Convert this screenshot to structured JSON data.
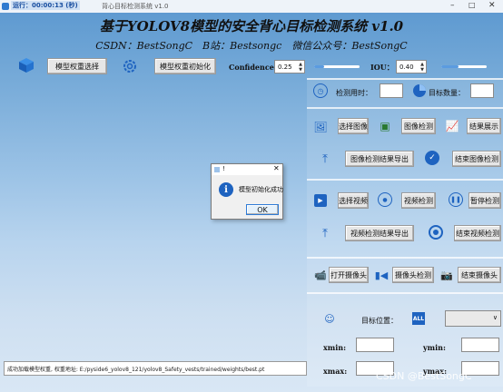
{
  "window": {
    "timer": "运行：00:00:13 (秒)",
    "title": "背心目标检测系统 v1.0"
  },
  "header": {
    "title": "基于YOLOV8模型的安全背心目标检测系统 v1.0",
    "subtitle": "CSDN：BestSongC　B站：Bestsongc　微信公众号：BestSongC"
  },
  "toolbar": {
    "model_select": "模型权重选择",
    "model_init": "模型权重初始化",
    "confidence_label": "Confidence:",
    "confidence_value": "0.25",
    "confidence_level": 0.22,
    "iou_label": "IOU：",
    "iou_value": "0.40",
    "iou_level": 0.38
  },
  "right": {
    "detect_time_label": "检测用时：",
    "target_count_label": "目标数量：",
    "select_image": "选择图像",
    "image_detect": "图像检测",
    "show_results": "结果展示",
    "export_image": "图像检测结果导出",
    "end_image": "结束图像检测",
    "select_video": "选择视频",
    "video_detect": "视频检测",
    "pause_detect": "暂停检测",
    "export_video": "视频检测结果导出",
    "end_video": "结束视频检测",
    "open_camera": "打开摄像头",
    "camera_detect": "摄像头检测",
    "end_camera": "结束摄像头",
    "target_position_label": "目标位置：",
    "all_badge": "ALL",
    "xmin": "xmin:",
    "ymin": "ymin:",
    "xmax": "xmax:",
    "ymax": "ymax:"
  },
  "status": {
    "text": "成功加载模型权重, 权重地址: E:/pyside6_yolov8_121/yolov8_Safety_vests/trained/weights/best.pt"
  },
  "dialog": {
    "title": "!",
    "message": "模型初始化成功",
    "ok": "OK"
  },
  "watermark": "CSDN @BestSongC",
  "colors": {
    "accent": "#1e63c0",
    "sky_top": "#5a97cf",
    "sky_bottom": "#d9e7f5"
  }
}
